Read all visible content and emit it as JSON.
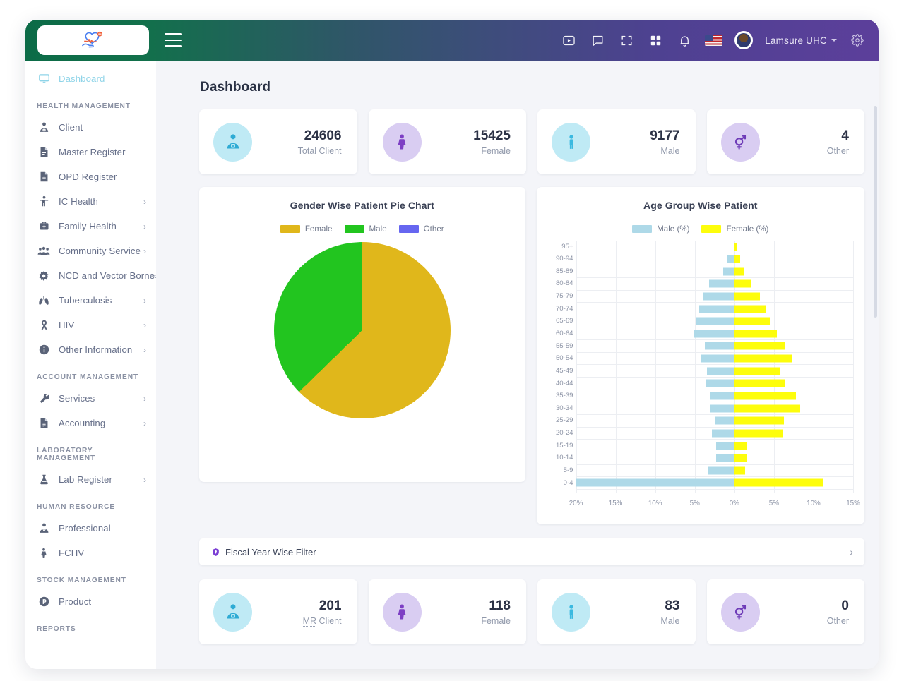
{
  "header": {
    "logo_alt": "heart-care-logo",
    "menu_toggle": "menu-toggle",
    "icons": [
      "video-icon",
      "chat-icon",
      "fullscreen-icon",
      "apps-grid-icon",
      "bell-icon"
    ],
    "flag": "us-flag-icon",
    "user_name": "Lamsure UHC",
    "settings": "gear-icon"
  },
  "sidebar": {
    "items": [
      {
        "label": "Dashboard",
        "icon": "dashboard-icon",
        "active": true,
        "chevron": false
      },
      {
        "section": "HEALTH MANAGEMENT"
      },
      {
        "label": "Client",
        "icon": "client-icon",
        "chevron": false
      },
      {
        "label": "Master Register",
        "icon": "master-register-icon",
        "chevron": false
      },
      {
        "label": "OPD Register",
        "icon": "opd-register-icon",
        "chevron": false
      },
      {
        "label": "IC Health",
        "icon": "ic-health-icon",
        "chevron": true
      },
      {
        "label": "Family Health",
        "icon": "family-health-icon",
        "chevron": true
      },
      {
        "label": "Community Service",
        "icon": "community-service-icon",
        "chevron": true
      },
      {
        "label": "NCD and Vector Borne",
        "icon": "ncd-vector-borne-icon",
        "chevron": true
      },
      {
        "label": "Tuberculosis",
        "icon": "tuberculosis-icon",
        "chevron": true
      },
      {
        "label": "HIV",
        "icon": "hiv-ribbon-icon",
        "chevron": true
      },
      {
        "label": "Other Information",
        "icon": "info-icon",
        "chevron": true
      },
      {
        "section": "ACCOUNT MANAGEMENT"
      },
      {
        "label": "Services",
        "icon": "wrench-icon",
        "chevron": true
      },
      {
        "label": "Accounting",
        "icon": "accounting-icon",
        "chevron": true
      },
      {
        "section": "LABORATORY MANAGEMENT"
      },
      {
        "label": "Lab Register",
        "icon": "flask-icon",
        "chevron": true
      },
      {
        "section": "HUMAN RESOURCE"
      },
      {
        "label": "Professional",
        "icon": "professional-icon",
        "chevron": false
      },
      {
        "label": "FCHV",
        "icon": "fchv-icon",
        "chevron": false
      },
      {
        "section": "STOCK MANAGEMENT"
      },
      {
        "label": "Product",
        "icon": "product-icon",
        "chevron": false
      },
      {
        "section": "REPORTS"
      }
    ]
  },
  "main": {
    "page_title": "Dashboard",
    "top_stats": [
      {
        "value": "24606",
        "label": "Total Client",
        "icon": "client-badge-icon",
        "color": "#bfeaf5",
        "icon_color": "#2eabd4"
      },
      {
        "value": "15425",
        "label": "Female",
        "icon": "female-icon",
        "color": "#d9cdf2",
        "icon_color": "#7d3fc4"
      },
      {
        "value": "9177",
        "label": "Male",
        "icon": "male-icon",
        "color": "#bfeaf5",
        "icon_color": "#3bb9e0"
      },
      {
        "value": "4",
        "label": "Other",
        "icon": "other-gender-icon",
        "color": "#d9cdf2",
        "icon_color": "#6f3cb8"
      }
    ],
    "fiscal_filter": {
      "label": "Fiscal Year Wise Filter",
      "icon": "shield-icon",
      "chevron": "›"
    },
    "bottom_stats": [
      {
        "value": "201",
        "label": "MR Client",
        "icon": "client-badge-icon",
        "color": "#bfeaf5",
        "icon_color": "#2eabd4"
      },
      {
        "value": "118",
        "label": "Female",
        "icon": "female-icon",
        "color": "#d9cdf2",
        "icon_color": "#7d3fc4"
      },
      {
        "value": "83",
        "label": "Male",
        "icon": "male-icon",
        "color": "#bfeaf5",
        "icon_color": "#3bb9e0"
      },
      {
        "value": "0",
        "label": "Other",
        "icon": "other-gender-icon",
        "color": "#d9cdf2",
        "icon_color": "#6f3cb8"
      }
    ]
  },
  "chart_data": [
    {
      "type": "pie",
      "title": "Gender Wise Patient Pie Chart",
      "legend_position": "top",
      "labels": [
        "Female",
        "Male",
        "Other"
      ],
      "values": [
        62.7,
        37.3,
        0.0
      ],
      "counts": [
        15425,
        9177,
        4
      ],
      "colors": [
        "#e0b71b",
        "#22c51f",
        "#6666f0"
      ]
    },
    {
      "type": "bar",
      "subtype": "population-pyramid",
      "title": "Age Group Wise Patient",
      "legend_position": "top",
      "xlabel": "",
      "ylabel": "",
      "grid": true,
      "xlim": [
        -20,
        15
      ],
      "xticks": [
        -20,
        -15,
        -10,
        -5,
        0,
        5,
        10,
        15
      ],
      "xtick_labels": [
        "20%",
        "15%",
        "10%",
        "5%",
        "0%",
        "5%",
        "10%",
        "15%"
      ],
      "categories": [
        "95+",
        "90-94",
        "85-89",
        "80-84",
        "75-79",
        "70-74",
        "65-69",
        "60-64",
        "55-59",
        "50-54",
        "45-49",
        "40-44",
        "35-39",
        "30-34",
        "25-29",
        "20-24",
        "15-19",
        "10-14",
        "5-9",
        "0-4"
      ],
      "series": [
        {
          "name": "Male (%)",
          "color": "#aed9e8",
          "values": [
            0.1,
            0.9,
            1.4,
            3.2,
            3.9,
            4.4,
            4.8,
            5.1,
            3.7,
            4.3,
            3.5,
            3.6,
            3.1,
            3.0,
            2.4,
            2.8,
            2.3,
            2.3,
            3.3,
            20.0
          ]
        },
        {
          "name": "Female (%)",
          "color": "#fdfd0c",
          "values": [
            0.3,
            0.7,
            1.3,
            2.2,
            3.2,
            3.9,
            4.5,
            5.4,
            6.4,
            7.2,
            5.7,
            6.4,
            7.8,
            8.3,
            6.3,
            6.2,
            1.5,
            1.6,
            1.4,
            11.3
          ]
        }
      ]
    }
  ]
}
